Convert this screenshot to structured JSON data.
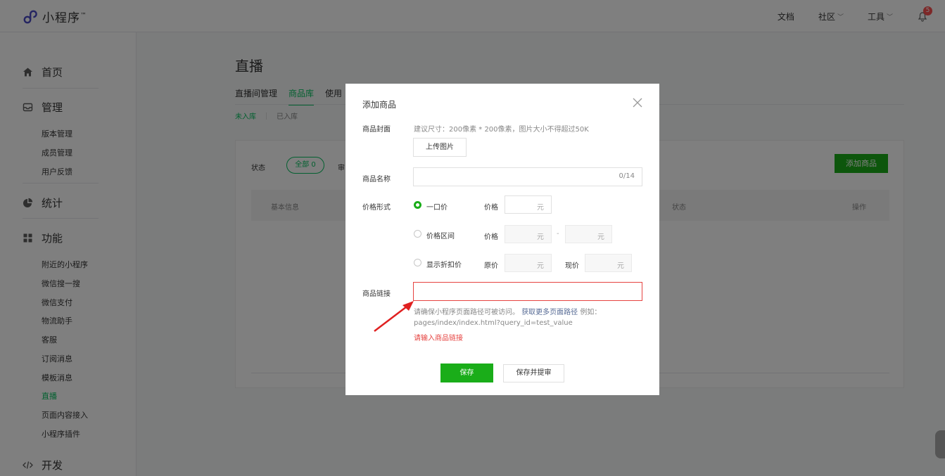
{
  "header": {
    "logo_text": "小程序",
    "logo_tm": "™",
    "nav": {
      "docs": "文档",
      "community": "社区",
      "tools": "工具"
    },
    "notification_count": "5"
  },
  "sidebar": {
    "home": "首页",
    "manage": "管理",
    "manage_items": [
      "版本管理",
      "成员管理",
      "用户反馈"
    ],
    "stats": "统计",
    "features": "功能",
    "feature_items": [
      "附近的小程序",
      "微信搜一搜",
      "微信支付",
      "物流助手",
      "客服",
      "订阅消息",
      "模板消息",
      "直播",
      "页面内容接入",
      "小程序插件"
    ],
    "active_item": "直播",
    "dev": "开发"
  },
  "main": {
    "title": "直播",
    "tabs": [
      "直播间管理",
      "商品库",
      "使用"
    ],
    "active_tab": "商品库",
    "subtabs": [
      "未入库",
      "已入库"
    ],
    "filter_label": "状态",
    "filter_all": "全部 0",
    "filter_partial": "审",
    "add_button": "添加商品",
    "table_headers": {
      "basic": "基本信息",
      "status": "状态",
      "action": "操作"
    }
  },
  "dialog": {
    "title": "添加商品",
    "cover_label": "商品封面",
    "cover_hint": "建议尺寸：200像素 * 200像素，图片大小不得超过50K",
    "upload_button": "上传图片",
    "name_label": "商品名称",
    "name_counter": "0/14",
    "price_type_label": "价格形式",
    "price_options": [
      {
        "label": "一口价",
        "selected": true
      },
      {
        "label": "价格区间",
        "selected": false
      },
      {
        "label": "显示折扣价",
        "selected": false
      }
    ],
    "price_label": "价格",
    "original_price_label": "原价",
    "current_price_label": "现价",
    "unit": "元",
    "range_dash": "-",
    "link_label": "商品链接",
    "link_hint_prefix": "请确保小程序页面路径可被访问。",
    "link_hint_link": "获取更多页面路径",
    "link_hint_suffix": " 例如：pages/index/index.html?query_id=test_value",
    "link_error": "请输入商品链接",
    "save_button": "保存",
    "save_submit_button": "保存并提审"
  },
  "colors": {
    "brand_green": "#1aad19",
    "accent_green": "#07c160",
    "error_red": "#e64340",
    "link_blue": "#576b95"
  }
}
